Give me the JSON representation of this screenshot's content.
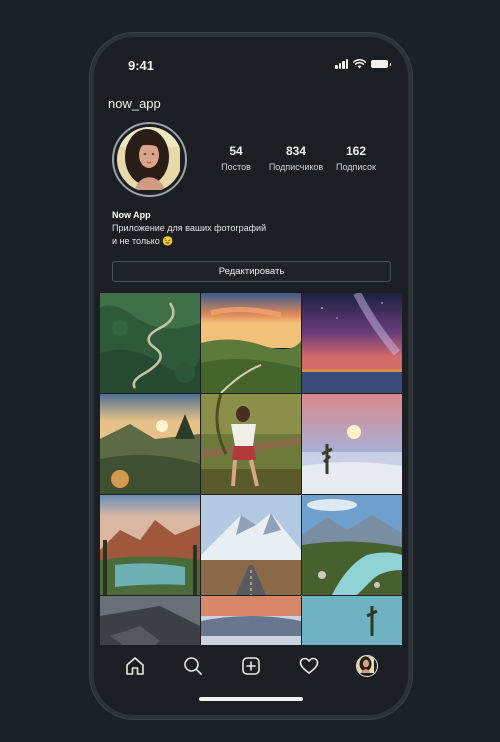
{
  "status_bar": {
    "time": "9:41",
    "icons": [
      "signal-icon",
      "wifi-icon",
      "battery-icon"
    ]
  },
  "profile": {
    "username": "now_app",
    "stats": [
      {
        "value": "54",
        "label": "Постов"
      },
      {
        "value": "834",
        "label": "Подписчиков"
      },
      {
        "value": "162",
        "label": "Подписок"
      }
    ],
    "bio_name": "Now App",
    "bio_line1": "Приложение для ваших фотографий",
    "bio_line2": "и не только 😉",
    "edit_button": "Редактировать"
  },
  "grid": {
    "photos": [
      "green-valley-road",
      "sunset-hills",
      "milky-way-lake",
      "mountain-sunset",
      "girl-on-fence",
      "moon-desert",
      "canyon-river",
      "snowy-mountain-road",
      "alpine-stream",
      "rocky-cliff",
      "snow-field",
      "lake-tree"
    ]
  },
  "tab_bar": {
    "items": [
      "home-icon",
      "search-icon",
      "add-icon",
      "heart-icon",
      "profile-avatar"
    ]
  },
  "colors": {
    "background": "#1c2027",
    "phone_frame": "#2d3237",
    "screen": "#1b1f24",
    "text": "#e9ecef"
  }
}
